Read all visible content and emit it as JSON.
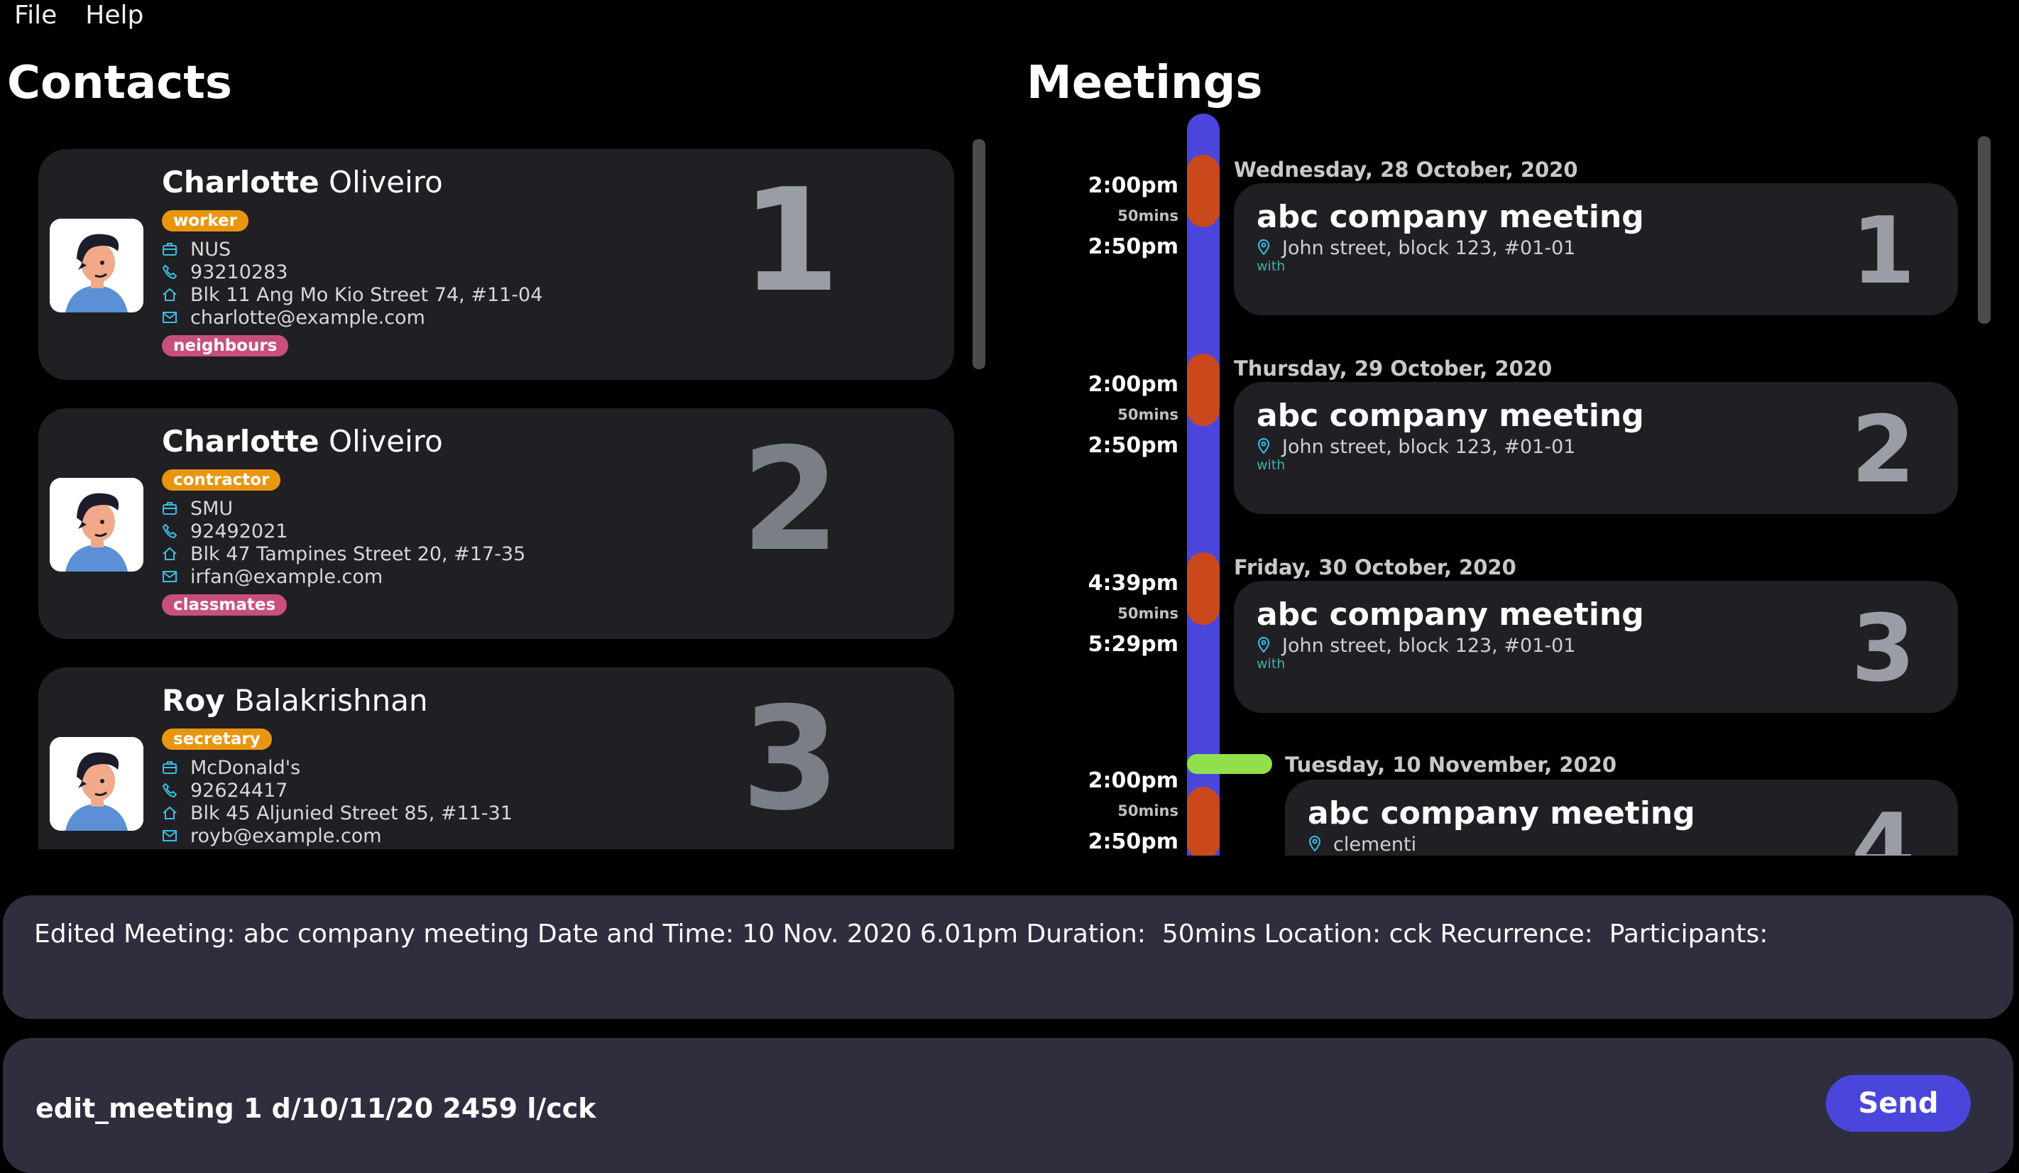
{
  "menu": {
    "file": "File",
    "help": "Help"
  },
  "contacts": {
    "title": "Contacts",
    "items": [
      {
        "first": "Charlotte",
        "last": "Oliveiro",
        "role": "worker",
        "org": "NUS",
        "phone": "93210283",
        "address": "Blk 11 Ang Mo Kio Street 74, #11-04",
        "email": "charlotte@example.com",
        "tag": "neighbours",
        "index": "1"
      },
      {
        "first": "Charlotte",
        "last": "Oliveiro",
        "role": "contractor",
        "org": "SMU",
        "phone": "92492021",
        "address": "Blk 47 Tampines Street 20, #17-35",
        "email": "irfan@example.com",
        "tag": "classmates",
        "index": "2"
      },
      {
        "first": "Roy",
        "last": "Balakrishnan",
        "role": "secretary",
        "org": "McDonald's",
        "phone": "92624417",
        "address": "Blk 45 Aljunied Street 85, #11-31",
        "email": "royb@example.com",
        "index": "3"
      }
    ]
  },
  "meetings": {
    "title": "Meetings",
    "items": [
      {
        "start": "2:00pm",
        "duration": "50mins",
        "end": "2:50pm",
        "date": "Wednesday, 28 October, 2020",
        "name": "abc company meeting",
        "location": "John street, block 123, #01-01",
        "with": "with",
        "index": "1"
      },
      {
        "start": "2:00pm",
        "duration": "50mins",
        "end": "2:50pm",
        "date": "Thursday, 29 October, 2020",
        "name": "abc company meeting",
        "location": "John street, block 123, #01-01",
        "with": "with",
        "index": "2"
      },
      {
        "start": "4:39pm",
        "duration": "50mins",
        "end": "5:29pm",
        "date": "Friday, 30 October, 2020",
        "name": "abc company meeting",
        "location": "John street, block 123, #01-01",
        "with": "with",
        "index": "3"
      },
      {
        "start": "2:00pm",
        "duration": "50mins",
        "end": "2:50pm",
        "date": "Tuesday, 10 November, 2020",
        "name": "abc company meeting",
        "location": "clementi",
        "index": "4"
      }
    ]
  },
  "result": {
    "text": "Edited Meeting: abc company meeting Date and Time: 10 Nov. 2020 6.01pm Duration:  50mins Location: cck Recurrence:  Participants: "
  },
  "command": {
    "value": "edit_meeting 1 d/10/11/20 2459 l/cck",
    "send_label": "Send"
  },
  "colors": {
    "accent": "#4a46dc",
    "role_tag": "#e8960f",
    "group_tag": "#c74f7d",
    "timeline_segment": "#c9491d",
    "now_marker": "#8fe04a",
    "card_bg": "#1f1f24",
    "box_bg": "#2e2e3e",
    "with_text": "#3ab1a6"
  },
  "icons": {
    "org": "briefcase-icon",
    "phone": "phone-icon",
    "address": "home-icon",
    "email": "mail-icon",
    "location": "location-pin-icon"
  }
}
